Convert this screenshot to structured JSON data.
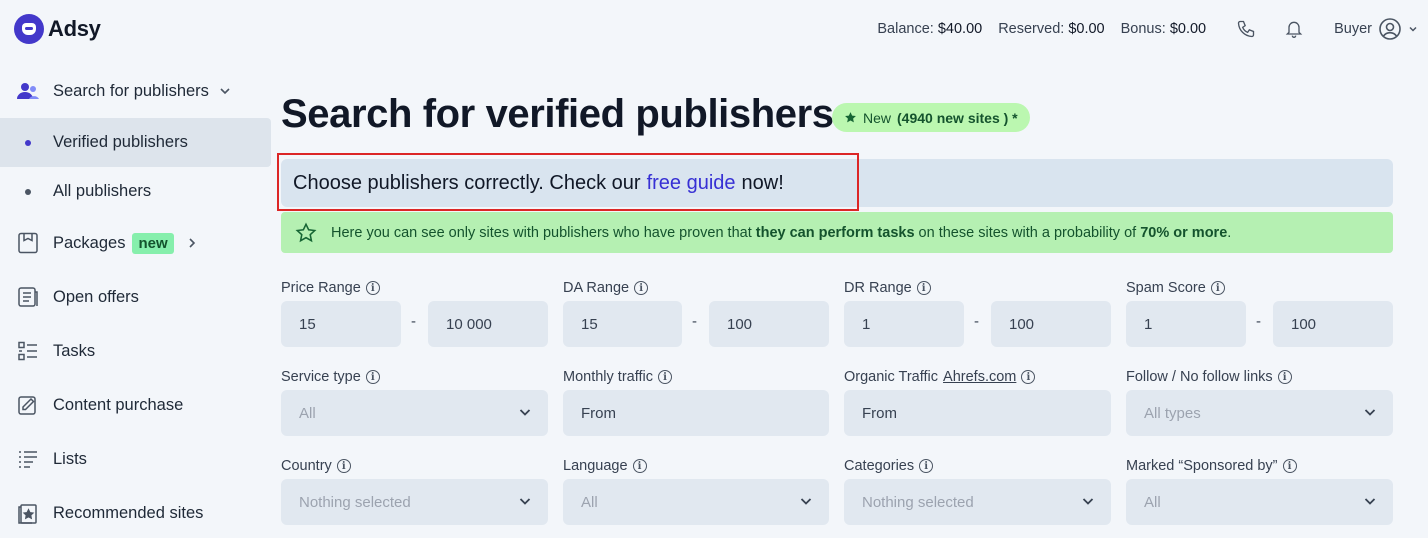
{
  "app": {
    "name": "Adsy"
  },
  "topbar": {
    "balance_label": "Balance:",
    "balance_value": "$40.00",
    "reserved_label": "Reserved:",
    "reserved_value": "$0.00",
    "bonus_label": "Bonus:",
    "bonus_value": "$0.00",
    "user_role": "Buyer"
  },
  "sidebar": {
    "section": "Search for publishers",
    "sub_items": [
      {
        "label": "Verified publishers"
      },
      {
        "label": "All publishers"
      }
    ],
    "items": [
      {
        "label": "Packages",
        "badge": "new"
      },
      {
        "label": "Open offers"
      },
      {
        "label": "Tasks"
      },
      {
        "label": "Content purchase"
      },
      {
        "label": "Lists"
      },
      {
        "label": "Recommended sites"
      }
    ]
  },
  "main": {
    "title": "Search for verified publishers",
    "new_pill": {
      "label": "New",
      "count": "(4940 new sites ) *"
    },
    "guide": {
      "before": "Choose publishers correctly. Check our",
      "link": "free guide",
      "after": "now!"
    },
    "info": {
      "t1": "Here you can see only sites with publishers who have proven that ",
      "b1": "they can perform tasks",
      "t2": " on these sites with a probability of ",
      "b2": "70% or more",
      "t3": "."
    }
  },
  "filters": {
    "price": {
      "label": "Price Range",
      "min": "15",
      "max": "10 000"
    },
    "da": {
      "label": "DA Range",
      "min": "15",
      "max": "100"
    },
    "dr": {
      "label": "DR Range",
      "min": "1",
      "max": "100"
    },
    "spam": {
      "label": "Spam Score",
      "min": "1",
      "max": "100"
    },
    "service_type": {
      "label": "Service type",
      "value": "All"
    },
    "monthly_traffic": {
      "label": "Monthly traffic",
      "value": "From"
    },
    "organic_traffic": {
      "label": "Organic Traffic",
      "link": "Ahrefs.com",
      "value": "From"
    },
    "follow": {
      "label": "Follow / No follow links",
      "value": "All types"
    },
    "country": {
      "label": "Country",
      "value": "Nothing selected"
    },
    "language": {
      "label": "Language",
      "value": "All"
    },
    "categories": {
      "label": "Categories",
      "value": "Nothing selected"
    },
    "sponsored": {
      "label": "Marked “Sponsored by”",
      "value": "All"
    },
    "range_separator": "-"
  },
  "colors": {
    "accent": "#4338ca",
    "link": "#3730d4",
    "success": "#b5f0b2",
    "highlight": "#dc2626"
  }
}
